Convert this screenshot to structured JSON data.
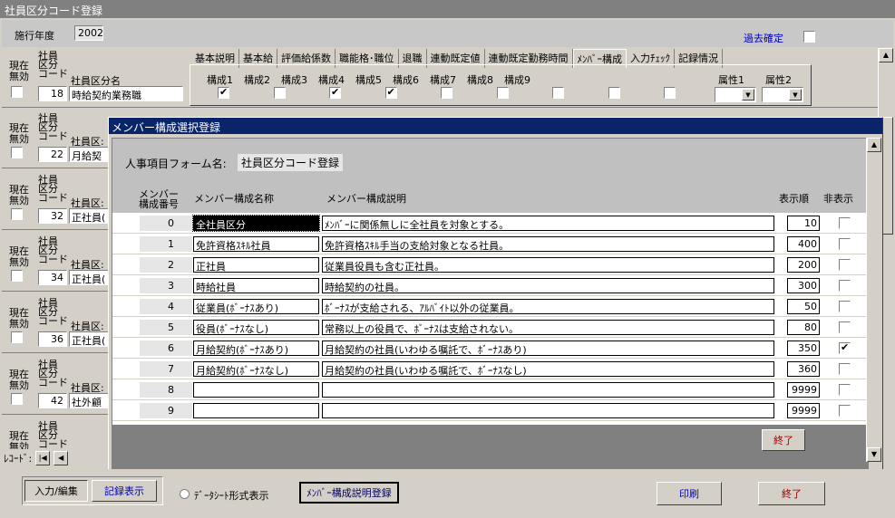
{
  "window": {
    "title": "社員区分コード登録"
  },
  "header": {
    "year_label": "施行年度",
    "year_value": "2002",
    "past_confirm_label": "過去確定"
  },
  "left_columns": {
    "current": "現在",
    "invalid": "無効",
    "emp": "社員",
    "cat": "区分",
    "code": "コード",
    "cat_name": "社員区分名"
  },
  "record1": {
    "code": "18",
    "name": "時給契約業務職"
  },
  "partial_records": [
    {
      "code": "22",
      "name": "月給契"
    },
    {
      "code": "32",
      "name": "正社員("
    },
    {
      "code": "34",
      "name": "正社員("
    },
    {
      "code": "36",
      "name": "正社員("
    },
    {
      "code": "42",
      "name": "社外顧"
    }
  ],
  "partial_cat_label": "社員区:",
  "tabs": [
    "基本説明",
    "基本給",
    "評価給係数",
    "職能格･職位",
    "退職",
    "連動既定値",
    "連動既定勤務時間",
    "ﾒﾝﾊﾞｰ構成",
    "入力ﾁｪｯｸ",
    "記録情況"
  ],
  "members": [
    {
      "label": "構成1",
      "checked": true
    },
    {
      "label": "構成2",
      "checked": false
    },
    {
      "label": "構成3",
      "checked": true
    },
    {
      "label": "構成4",
      "checked": true
    },
    {
      "label": "構成5",
      "checked": false
    },
    {
      "label": "構成6",
      "checked": false
    },
    {
      "label": "構成7",
      "checked": false
    },
    {
      "label": "構成8",
      "checked": false
    },
    {
      "label": "構成9",
      "checked": false
    }
  ],
  "attributes": {
    "attr1": "属性1",
    "attr2": "属性2"
  },
  "record_nav_label": "ﾚｺｰﾄﾞ:",
  "dialog": {
    "title": "メンバー構成選択登録",
    "form_name_label": "人事項目フォーム名:",
    "form_name_value": "社員区分コード登録",
    "col_no": "メンバー構成番号",
    "col_name": "メンバー構成名称",
    "col_desc": "メンバー構成説明",
    "col_order": "表示順",
    "col_hidden": "非表示",
    "close_button": "終了",
    "rows": [
      {
        "no": "0",
        "name": "全社員区分",
        "desc": "ﾒﾝﾊﾞｰに関係無しに全社員を対象とする。",
        "order": "10",
        "hidden": false
      },
      {
        "no": "1",
        "name": "免許資格ｽｷﾙ社員",
        "desc": "免許資格ｽｷﾙ手当の支給対象となる社員。",
        "order": "400",
        "hidden": false
      },
      {
        "no": "2",
        "name": "正社員",
        "desc": "従業員役員も含む正社員。",
        "order": "200",
        "hidden": false
      },
      {
        "no": "3",
        "name": "時給社員",
        "desc": "時給契約の社員。",
        "order": "300",
        "hidden": false
      },
      {
        "no": "4",
        "name": "従業員(ﾎﾞｰﾅｽあり)",
        "desc": "ﾎﾞｰﾅｽが支給される、ｱﾙﾊﾞｲﾄ以外の従業員。",
        "order": "50",
        "hidden": false
      },
      {
        "no": "5",
        "name": "役員(ﾎﾞｰﾅｽなし)",
        "desc": "常務以上の役員で、ﾎﾞｰﾅｽは支給されない。",
        "order": "80",
        "hidden": false
      },
      {
        "no": "6",
        "name": "月給契約(ﾎﾞｰﾅｽあり)",
        "desc": "月給契約の社員(いわゆる嘱託で、ﾎﾞｰﾅｽあり)",
        "order": "350",
        "hidden": true
      },
      {
        "no": "7",
        "name": "月給契約(ﾎﾞｰﾅｽなし)",
        "desc": "月給契約の社員(いわゆる嘱託で、ﾎﾞｰﾅｽなし)",
        "order": "360",
        "hidden": false
      },
      {
        "no": "8",
        "name": "",
        "desc": "",
        "order": "9999",
        "hidden": false
      },
      {
        "no": "9",
        "name": "",
        "desc": "",
        "order": "9999",
        "hidden": false
      }
    ]
  },
  "footer": {
    "input_edit": "入力/編集",
    "record_view": "記録表示",
    "datasheet": "ﾃﾞｰﾀｼｰﾄ形式表示",
    "member_desc": "ﾒﾝﾊﾞｰ構成説明登録",
    "print": "印刷",
    "close": "終了"
  }
}
